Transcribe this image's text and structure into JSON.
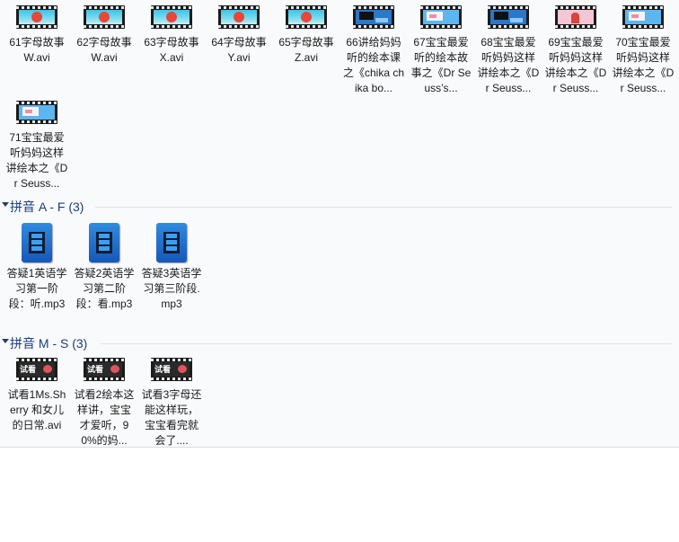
{
  "row1": [
    {
      "thumb": "alpha",
      "label": "61字母故事W.avi"
    },
    {
      "thumb": "alpha",
      "label": "62字母故事W.avi"
    },
    {
      "thumb": "alpha",
      "label": "63字母故事X.avi"
    },
    {
      "thumb": "alpha",
      "label": "64字母故事Y.avi"
    },
    {
      "thumb": "alpha",
      "label": "65字母故事Z.avi"
    },
    {
      "thumb": "bluebox",
      "label": "66讲给妈妈听的绘本课之《chika chika bo..."
    },
    {
      "thumb": "pinkbox",
      "label": "67宝宝最爱听的绘本故事之《Dr Seuss’s..."
    },
    {
      "thumb": "bluebox",
      "label": "68宝宝最爱听妈妈这样讲绘本之《Dr Seuss..."
    },
    {
      "thumb": "pinkgirl",
      "label": "69宝宝最爱听妈妈这样讲绘本之《Dr Seuss..."
    },
    {
      "thumb": "pinkbox",
      "label": "70宝宝最爱听妈妈这样讲绘本之《Dr Seuss..."
    }
  ],
  "row2": [
    {
      "thumb": "pinkbox",
      "label": "71宝宝最爱听妈妈这样讲绘本之《Dr Seuss..."
    }
  ],
  "groups": [
    {
      "title": "拼音 A - F (3)",
      "items": [
        {
          "icon": "mp3-file-icon",
          "label": "答疑1英语学习第一阶段：听.mp3"
        },
        {
          "icon": "mp3-file-icon",
          "label": "答疑2英语学习第二阶段：看.mp3"
        },
        {
          "icon": "mp3-file-icon",
          "label": "答疑3英语学习第三阶段.mp3"
        }
      ]
    },
    {
      "title": "拼音 M - S (3)",
      "items": [
        {
          "thumb": "trial",
          "label": "试看1Ms.Sherry 和女儿的日常.avi"
        },
        {
          "thumb": "trial",
          "label": "试看2绘本这样讲，宝宝才爱听，90%的妈..."
        },
        {
          "thumb": "trial",
          "label": "试看3字母还能这样玩，宝宝看完就会了...."
        }
      ]
    }
  ]
}
